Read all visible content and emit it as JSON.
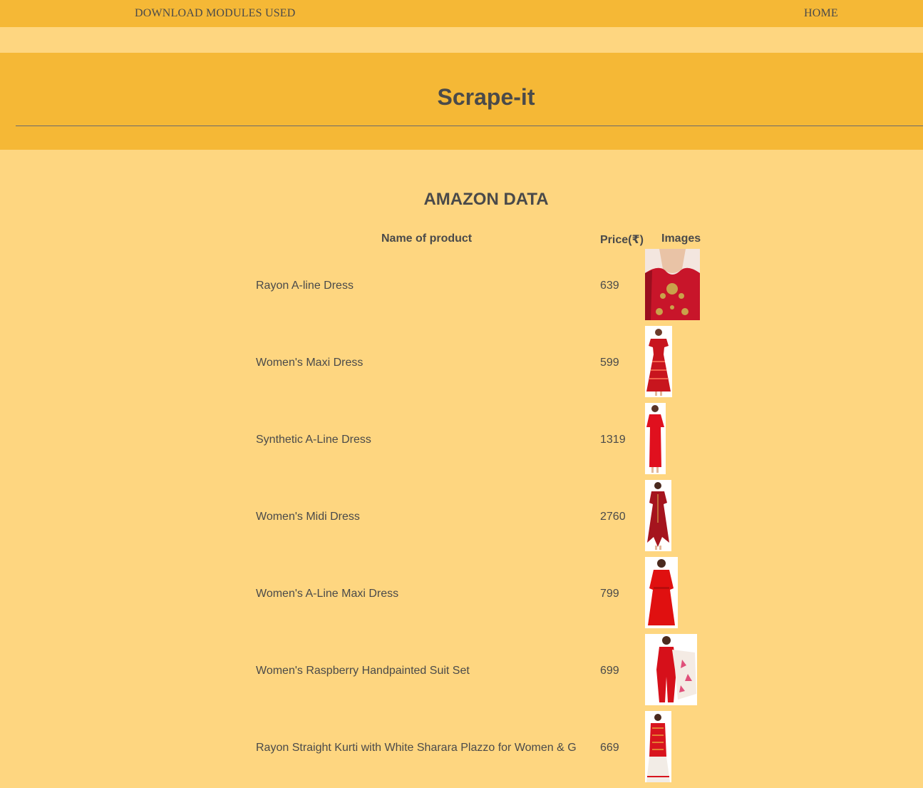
{
  "nav": {
    "download_label": "DOWNLOAD MODULES USED",
    "home_label": "HOME"
  },
  "header": {
    "title": "Scrape-it"
  },
  "section": {
    "title": "AMAZON DATA"
  },
  "table": {
    "headers": {
      "name": "Name of product",
      "price": "Price(₹)",
      "images": "Images"
    },
    "rows": [
      {
        "name": "Rayon A-line Dress",
        "price": "639",
        "image": "red-dress-closeup-photo"
      },
      {
        "name": "Women's Maxi Dress",
        "price": "599",
        "image": "red-maxi-dress-photo"
      },
      {
        "name": "Synthetic A-Line Dress",
        "price": "1319",
        "image": "red-a-line-dress-photo"
      },
      {
        "name": "Women's Midi Dress",
        "price": "2760",
        "image": "maroon-midi-dress-photo"
      },
      {
        "name": "Women's A-Line Maxi Dress",
        "price": "799",
        "image": "red-a-line-maxi-dress-photo"
      },
      {
        "name": "Women's Raspberry Handpainted Suit Set",
        "price": "699",
        "image": "raspberry-suit-set-photo"
      },
      {
        "name": "Rayon Straight Kurti with White Sharara Plazzo for Women & G",
        "price": "669",
        "image": "kurti-sharara-photo"
      }
    ]
  },
  "colors": {
    "page_background": "#FED680",
    "bar_background": "#F5B836",
    "text": "#4a4a4a",
    "product_red": "#D01818"
  }
}
